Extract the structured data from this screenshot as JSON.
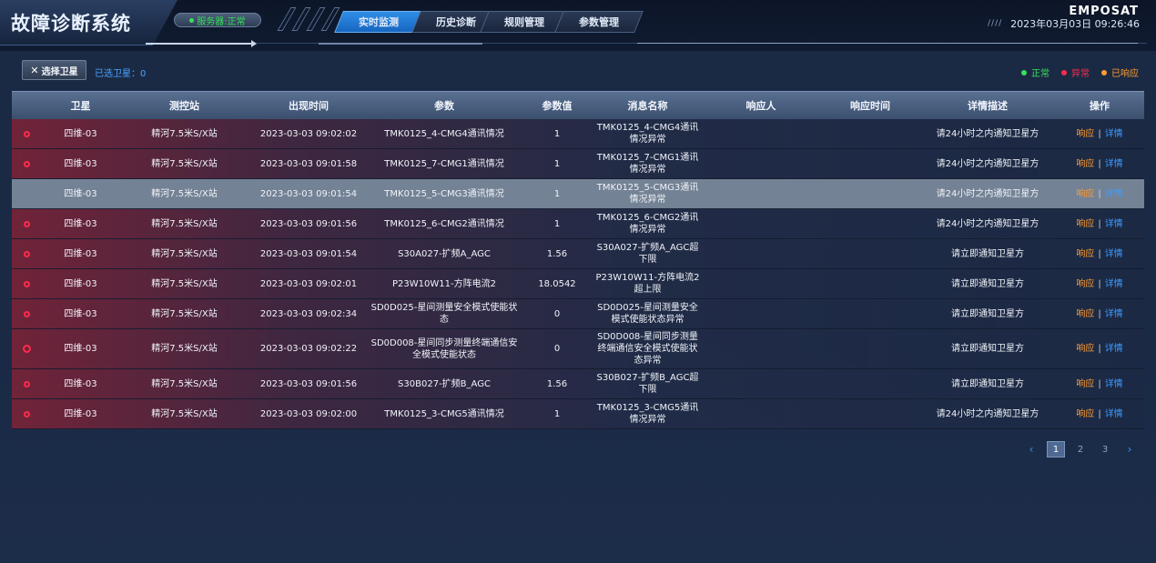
{
  "header": {
    "title": "故障诊断系统",
    "server_status": "服务器:正常",
    "brand": "EMPOSAT",
    "datetime": "2023年03月03日 09:26:46",
    "tabs": [
      {
        "label": "实时监测",
        "active": true
      },
      {
        "label": "历史诊断",
        "active": false
      },
      {
        "label": "规则管理",
        "active": false
      },
      {
        "label": "参数管理",
        "active": false
      }
    ]
  },
  "toolbar": {
    "select_button": "选择卫星",
    "selected_count": "已选卫星：0"
  },
  "legend": [
    {
      "label": "正常",
      "color": "#38e05a"
    },
    {
      "label": "异常",
      "color": "#ff2b4d"
    },
    {
      "label": "已响应",
      "color": "#ff9c33"
    }
  ],
  "table": {
    "columns": [
      "卫星",
      "测控站",
      "出现时间",
      "参数",
      "参数值",
      "消息名称",
      "响应人",
      "响应时间",
      "详情描述",
      "操作"
    ],
    "ops": {
      "respond": "响应",
      "separator": "|",
      "detail": "详情"
    },
    "rows": [
      {
        "sat": "四维-03",
        "station": "精河7.5米S/X站",
        "time": "2023-03-03 09:02:02",
        "param": "TMK0125_4-CMG4通讯情况",
        "value": "1",
        "msg": "TMK0125_4-CMG4通讯情况异常",
        "responder": "",
        "resp_time": "",
        "detail": "请24小时之内通知卫星方",
        "status": "abnormal"
      },
      {
        "sat": "四维-03",
        "station": "精河7.5米S/X站",
        "time": "2023-03-03 09:01:58",
        "param": "TMK0125_7-CMG1通讯情况",
        "value": "1",
        "msg": "TMK0125_7-CMG1通讯情况异常",
        "responder": "",
        "resp_time": "",
        "detail": "请24小时之内通知卫星方",
        "status": "abnormal"
      },
      {
        "sat": "四维-03",
        "station": "精河7.5米S/X站",
        "time": "2023-03-03 09:01:54",
        "param": "TMK0125_5-CMG3通讯情况",
        "value": "1",
        "msg": "TMK0125_5-CMG3通讯情况异常",
        "responder": "",
        "resp_time": "",
        "detail": "请24小时之内通知卫星方",
        "status": "selected"
      },
      {
        "sat": "四维-03",
        "station": "精河7.5米S/X站",
        "time": "2023-03-03 09:01:56",
        "param": "TMK0125_6-CMG2通讯情况",
        "value": "1",
        "msg": "TMK0125_6-CMG2通讯情况异常",
        "responder": "",
        "resp_time": "",
        "detail": "请24小时之内通知卫星方",
        "status": "abnormal"
      },
      {
        "sat": "四维-03",
        "station": "精河7.5米S/X站",
        "time": "2023-03-03 09:01:54",
        "param": "S30A027-扩频A_AGC",
        "value": "1.56",
        "msg": "S30A027-扩频A_AGC超下限",
        "responder": "",
        "resp_time": "",
        "detail": "请立即通知卫星方",
        "status": "abnormal"
      },
      {
        "sat": "四维-03",
        "station": "精河7.5米S/X站",
        "time": "2023-03-03 09:02:01",
        "param": "P23W10W11-方阵电流2",
        "value": "18.0542",
        "msg": "P23W10W11-方阵电流2超上限",
        "responder": "",
        "resp_time": "",
        "detail": "请立即通知卫星方",
        "status": "abnormal"
      },
      {
        "sat": "四维-03",
        "station": "精河7.5米S/X站",
        "time": "2023-03-03 09:02:34",
        "param": "SD0D025-星间测量安全模式使能状态",
        "value": "0",
        "msg": "SD0D025-星间测量安全模式使能状态异常",
        "responder": "",
        "resp_time": "",
        "detail": "请立即通知卫星方",
        "status": "abnormal"
      },
      {
        "sat": "四维-03",
        "station": "精河7.5米S/X站",
        "time": "2023-03-03 09:02:22",
        "param": "SD0D008-星间同步测量终端通信安全模式使能状态",
        "value": "0",
        "msg": "SD0D008-星间同步测量终端通信安全模式使能状态异常",
        "responder": "",
        "resp_time": "",
        "detail": "请立即通知卫星方",
        "status": "abnormal-tall"
      },
      {
        "sat": "四维-03",
        "station": "精河7.5米S/X站",
        "time": "2023-03-03 09:01:56",
        "param": "S30B027-扩频B_AGC",
        "value": "1.56",
        "msg": "S30B027-扩频B_AGC超下限",
        "responder": "",
        "resp_time": "",
        "detail": "请立即通知卫星方",
        "status": "abnormal"
      },
      {
        "sat": "四维-03",
        "station": "精河7.5米S/X站",
        "time": "2023-03-03 09:02:00",
        "param": "TMK0125_3-CMG5通讯情况",
        "value": "1",
        "msg": "TMK0125_3-CMG5通讯情况异常",
        "responder": "",
        "resp_time": "",
        "detail": "请24小时之内通知卫星方",
        "status": "abnormal"
      }
    ]
  },
  "pagination": {
    "prev": "‹",
    "next": "›",
    "pages": [
      "1",
      "2",
      "3"
    ],
    "current": "1"
  }
}
